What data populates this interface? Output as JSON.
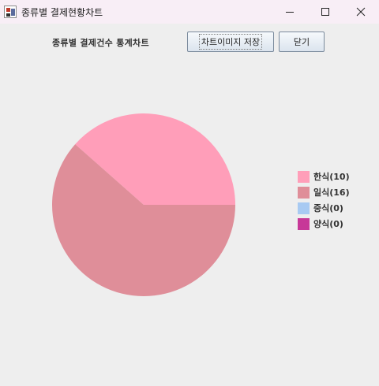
{
  "window": {
    "title": "종류별 결제현황차트"
  },
  "toolbar": {
    "label": "종류별 결제건수 통계차트",
    "save_label": "차트이미지 저장",
    "close_label": "닫기"
  },
  "chart_data": {
    "type": "pie",
    "title": "",
    "categories": [
      "한식",
      "일식",
      "중식",
      "양식"
    ],
    "values": [
      10,
      16,
      0,
      0
    ],
    "colors": [
      "#ff9eb9",
      "#df8e99",
      "#a8caf2",
      "#c73898"
    ],
    "legend_labels": [
      "한식(10)",
      "일식(16)",
      "중식(0)",
      "양식(0)"
    ],
    "legend_position": "right"
  }
}
